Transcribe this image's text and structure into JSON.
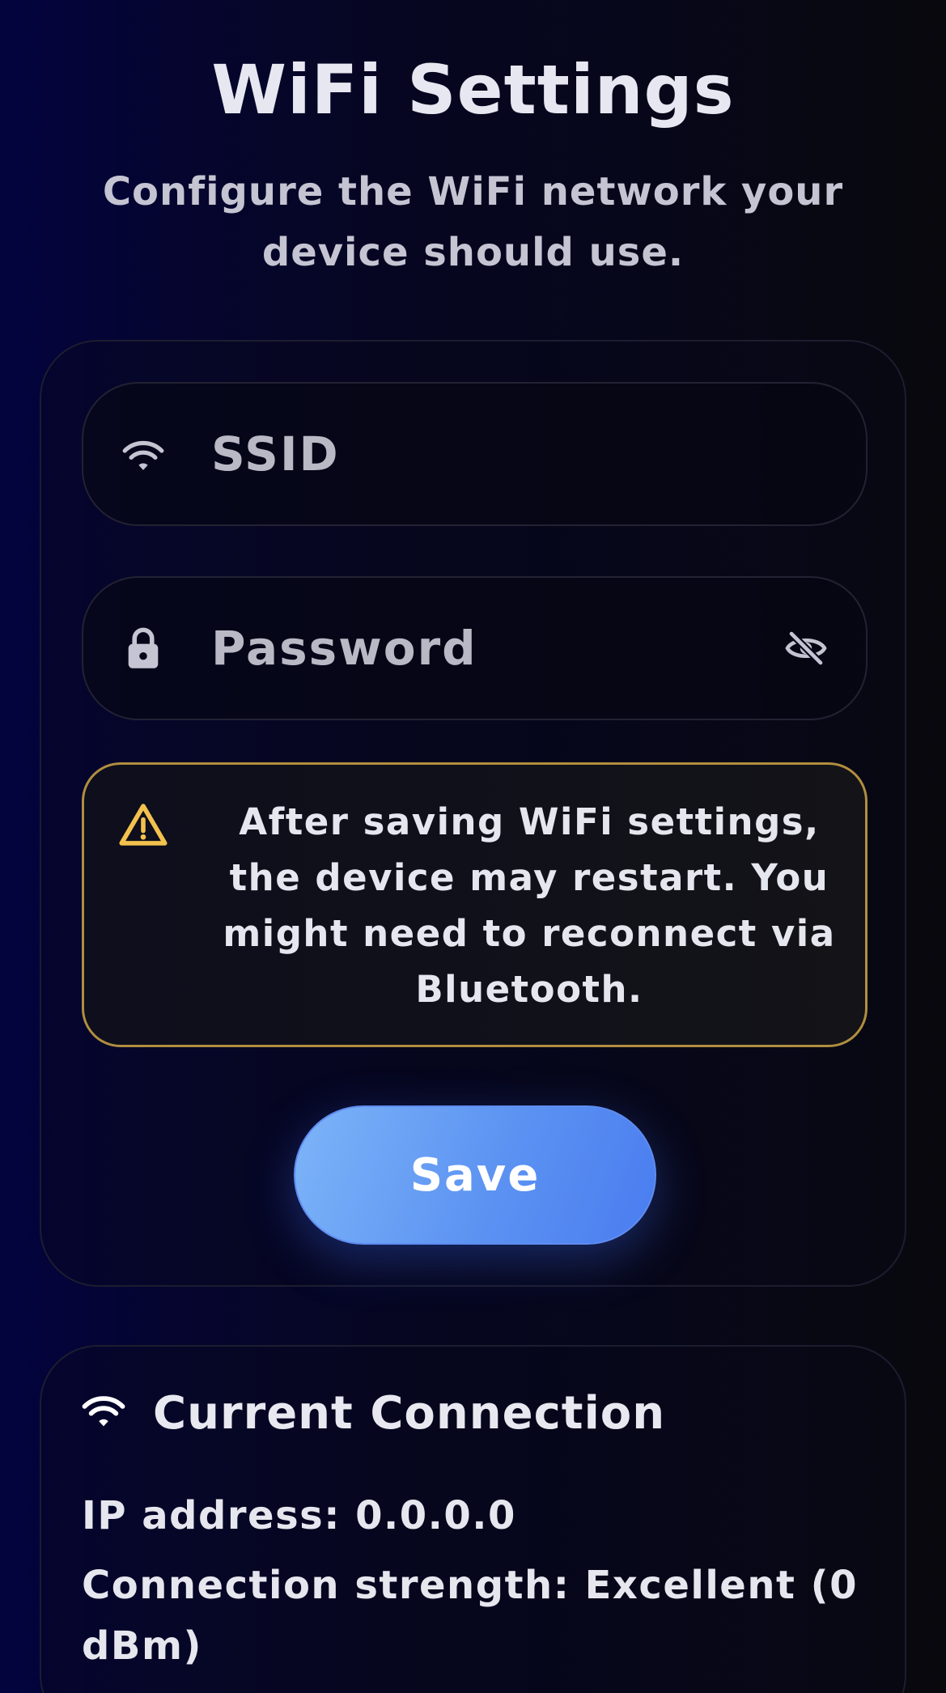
{
  "header": {
    "title": "WiFi Settings",
    "subtitle": "Configure the WiFi network your device should use."
  },
  "form": {
    "ssid": {
      "placeholder": "SSID",
      "value": "",
      "icon": "wifi-icon"
    },
    "password": {
      "placeholder": "Password",
      "value": "",
      "icon": "lock-icon",
      "toggle_icon": "eye-off-icon"
    },
    "warning": {
      "icon": "warning-icon",
      "text": "After saving WiFi settings, the device may restart. You might need to reconnect via Bluetooth."
    },
    "save_label": "Save"
  },
  "connection": {
    "title": "Current Connection",
    "icon": "wifi-icon",
    "ip_line": "IP address: 0.0.0.0",
    "strength_line": "Connection strength: Excellent (0 dBm)"
  },
  "colors": {
    "accent": "#5c93f2",
    "warning_border": "#b18e3f",
    "warning_icon": "#f2c14e"
  }
}
